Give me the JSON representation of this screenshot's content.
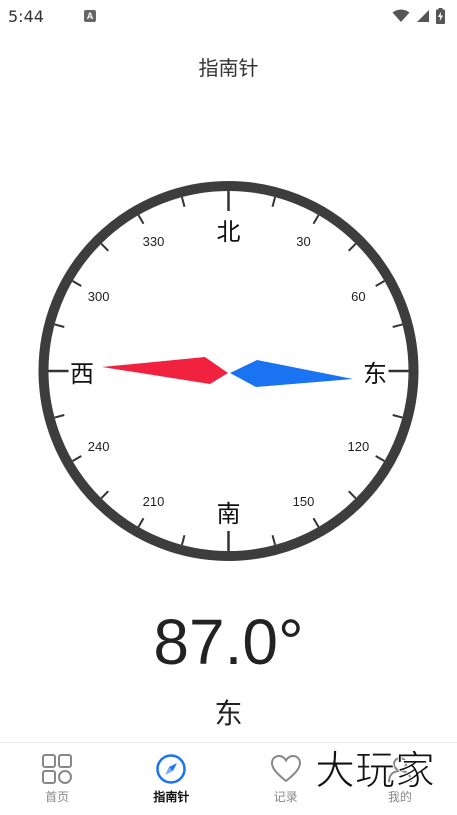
{
  "status_bar": {
    "time": "5:44",
    "notification_icon_letter": "A",
    "icons": [
      "wifi-icon",
      "signal-icon",
      "battery-charging-icon"
    ]
  },
  "title": "指南针",
  "compass": {
    "north": "北",
    "east": "东",
    "south": "南",
    "west": "西",
    "degree_labels": [
      "30",
      "60",
      "120",
      "150",
      "210",
      "240",
      "300",
      "330"
    ],
    "red_needle_color": "#f0223f",
    "blue_needle_color": "#1a73f0",
    "ring_color": "#3d3d3d"
  },
  "heading": "87.0°",
  "direction": "东",
  "tabs": [
    {
      "label": "首页",
      "icon": "grid-icon",
      "active": false
    },
    {
      "label": "指南针",
      "icon": "compass-icon",
      "active": true
    },
    {
      "label": "记录",
      "icon": "heart-icon",
      "active": false
    },
    {
      "label": "我的",
      "icon": "profile-icon",
      "active": false
    }
  ],
  "watermark": "大玩家"
}
